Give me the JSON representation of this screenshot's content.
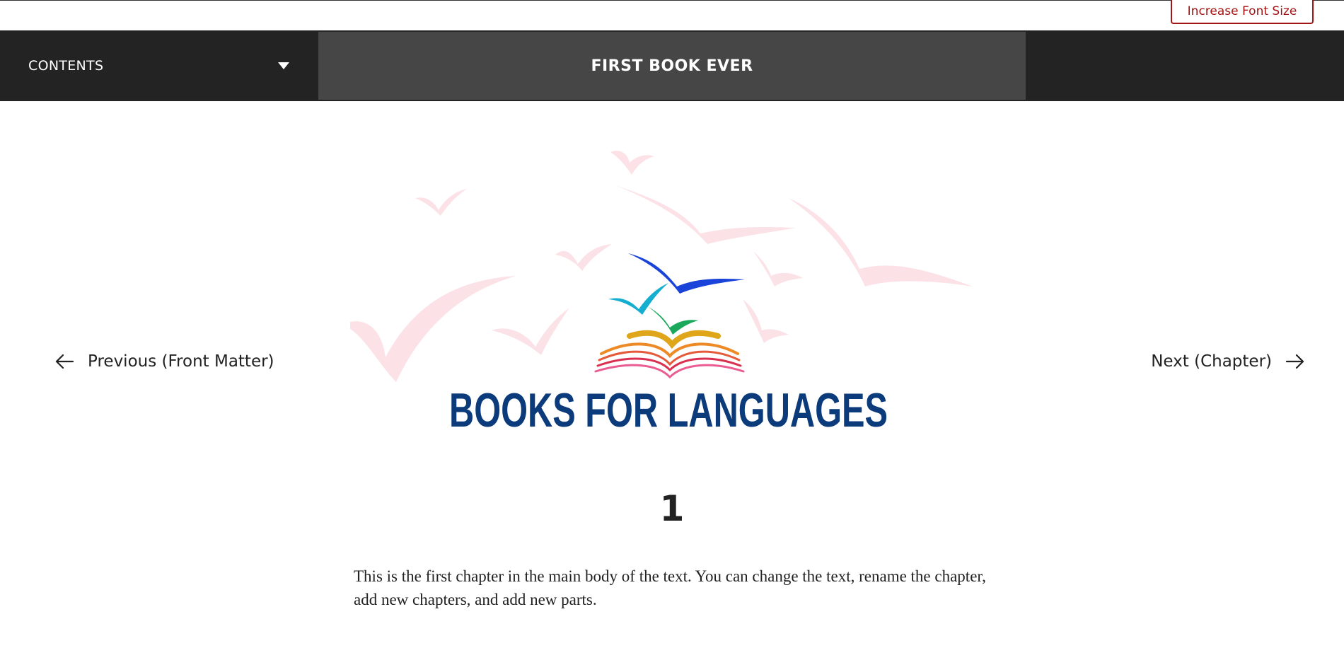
{
  "accessibility": {
    "increase_font_label": "Increase Font Size"
  },
  "header": {
    "contents_label": "CONTENTS",
    "book_title": "FIRST BOOK EVER"
  },
  "navigation": {
    "previous_label": "Previous (Front Matter)",
    "next_label": "Next (Chapter)"
  },
  "logo": {
    "text": "BOOKS FOR LANGUAGES",
    "icon": "flying-birds-open-book-logo"
  },
  "chapter": {
    "number": "1",
    "body": "This is the first chapter in the main body of the text. You can change the text, rename the chapter, add new chapters, and add new parts."
  },
  "colors": {
    "header_bg": "#232323",
    "title_bar_bg": "#464646",
    "accent_red": "#a31515",
    "logo_blue": "#0b3b7a"
  }
}
